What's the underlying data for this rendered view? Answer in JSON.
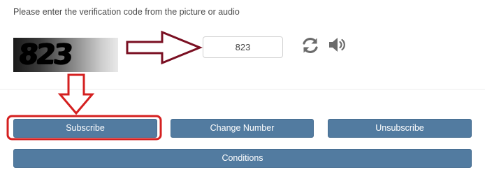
{
  "instruction": "Please enter the verification code from the picture or audio",
  "captcha": {
    "text": "823"
  },
  "code_input": {
    "value": "823"
  },
  "icons": {
    "refresh": "refresh-icon",
    "audio": "speaker-icon"
  },
  "buttons": {
    "subscribe": "Subscribe",
    "change_number": "Change Number",
    "unsubscribe": "Unsubscribe",
    "conditions": "Conditions"
  },
  "colors": {
    "button_bg": "#527ba0",
    "button_text": "#ffffff",
    "annotation_arrow": "#7a0f22",
    "annotation_highlight": "#d42020"
  }
}
